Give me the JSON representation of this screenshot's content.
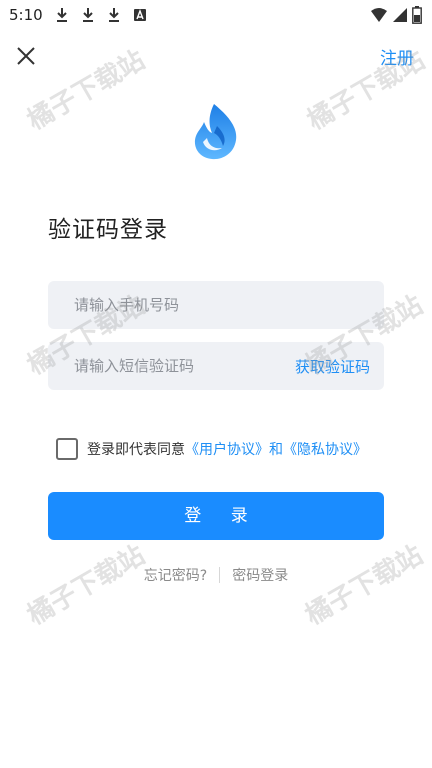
{
  "status_bar": {
    "time": "5:10",
    "left_icons": [
      "download-icon",
      "download-icon",
      "download-icon",
      "a-icon"
    ],
    "right_icons": [
      "wifi-icon",
      "signal-icon",
      "battery-icon"
    ]
  },
  "header": {
    "close_icon": "close-icon",
    "register_label": "注册"
  },
  "logo": {
    "icon": "flame-logo-icon",
    "colors": [
      "#1e7fe6",
      "#5fb8ff"
    ]
  },
  "title": "验证码登录",
  "form": {
    "phone_placeholder": "请输入手机号码",
    "phone_value": "",
    "code_placeholder": "请输入短信验证码",
    "code_value": "",
    "get_code_label": "获取验证码"
  },
  "agreement": {
    "checked": false,
    "prefix": "登录即代表同意",
    "user_agreement": "《用户协议》",
    "conjunction": "和",
    "privacy_policy": "《隐私协议》"
  },
  "login_button_label": "登 录",
  "bottom": {
    "forgot_password": "忘记密码?",
    "password_login": "密码登录"
  },
  "watermark_text": "橘子下载站",
  "colors": {
    "accent": "#1f8ff5",
    "button": "#1a8cff",
    "field_bg": "#eff1f5"
  }
}
